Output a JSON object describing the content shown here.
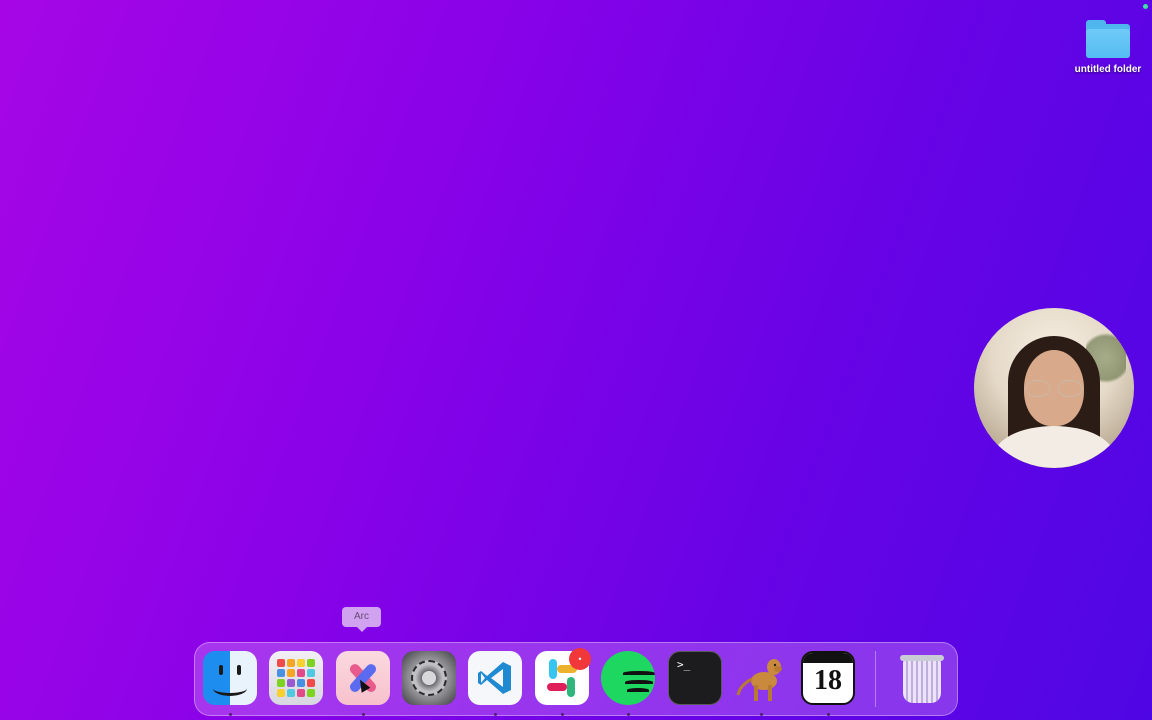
{
  "desktop": {
    "folder_label": "untitled folder",
    "colors": {
      "gradient_start": "#a606e6",
      "gradient_end": "#4f06e4"
    }
  },
  "tooltip": {
    "label": "Arc"
  },
  "dock": {
    "items": [
      {
        "name": "Finder",
        "icon": "finder-icon",
        "running": true
      },
      {
        "name": "Launchpad",
        "icon": "launchpad-icon",
        "running": false
      },
      {
        "name": "Arc",
        "icon": "arc-icon",
        "running": true
      },
      {
        "name": "System Settings",
        "icon": "settings-icon",
        "running": false
      },
      {
        "name": "Visual Studio Code",
        "icon": "vscode-icon",
        "running": true
      },
      {
        "name": "Slack",
        "icon": "slack-icon",
        "running": true
      },
      {
        "name": "Spotify",
        "icon": "spotify-icon",
        "running": true
      },
      {
        "name": "Terminal",
        "icon": "terminal-icon",
        "running": false
      },
      {
        "name": "Dog app",
        "icon": "dog-icon",
        "running": true
      },
      {
        "name": "Calendar",
        "icon": "calendar-icon",
        "running": true,
        "date_number": "18"
      },
      {
        "name": "Trash",
        "icon": "trash-icon",
        "running": false
      }
    ],
    "slack_badge": "•"
  }
}
